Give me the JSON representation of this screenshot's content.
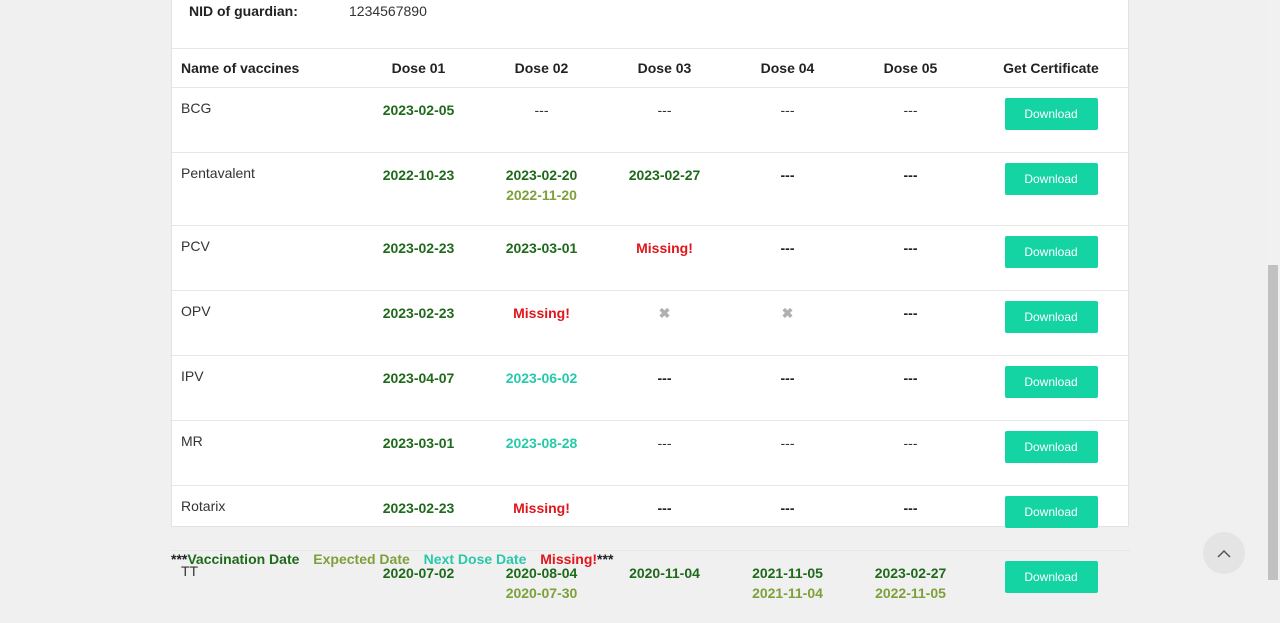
{
  "guardian": {
    "nid_label": "NID of guardian:",
    "nid_value": "1234567890"
  },
  "table": {
    "headers": [
      "Name of vaccines",
      "Dose 01",
      "Dose 02",
      "Dose 03",
      "Dose 04",
      "Dose 05",
      "Get Certificate"
    ],
    "download_label": "Download",
    "rows": [
      {
        "name": "BCG",
        "doses": [
          [
            {
              "t": "vd",
              "v": "2023-02-05"
            }
          ],
          [
            {
              "t": "dash",
              "v": "---"
            }
          ],
          [
            {
              "t": "dash",
              "v": "---"
            }
          ],
          [
            {
              "t": "dash",
              "v": "---"
            }
          ],
          [
            {
              "t": "dash",
              "v": "---"
            }
          ]
        ]
      },
      {
        "name": "Pentavalent",
        "doses": [
          [
            {
              "t": "vd",
              "v": "2022-10-23"
            }
          ],
          [
            {
              "t": "vd",
              "v": "2023-02-20"
            },
            {
              "t": "ed",
              "v": "2022-11-20"
            }
          ],
          [
            {
              "t": "vd",
              "v": "2023-02-27"
            }
          ],
          [
            {
              "t": "dashb",
              "v": "---"
            }
          ],
          [
            {
              "t": "dashb",
              "v": "---"
            }
          ]
        ]
      },
      {
        "name": "PCV",
        "doses": [
          [
            {
              "t": "vd",
              "v": "2023-02-23"
            }
          ],
          [
            {
              "t": "vd",
              "v": "2023-03-01"
            }
          ],
          [
            {
              "t": "ms",
              "v": "Missing!"
            }
          ],
          [
            {
              "t": "dashb",
              "v": "---"
            }
          ],
          [
            {
              "t": "dashb",
              "v": "---"
            }
          ]
        ]
      },
      {
        "name": "OPV",
        "doses": [
          [
            {
              "t": "vd",
              "v": "2023-02-23"
            }
          ],
          [
            {
              "t": "ms",
              "v": "Missing!"
            }
          ],
          [
            {
              "t": "xmark",
              "v": "✖"
            }
          ],
          [
            {
              "t": "xmark",
              "v": "✖"
            }
          ],
          [
            {
              "t": "dashb",
              "v": "---"
            }
          ]
        ]
      },
      {
        "name": "IPV",
        "doses": [
          [
            {
              "t": "vd",
              "v": "2023-04-07"
            }
          ],
          [
            {
              "t": "nd",
              "v": "2023-06-02"
            }
          ],
          [
            {
              "t": "dashb",
              "v": "---"
            }
          ],
          [
            {
              "t": "dashb",
              "v": "---"
            }
          ],
          [
            {
              "t": "dashb",
              "v": "---"
            }
          ]
        ]
      },
      {
        "name": "MR",
        "doses": [
          [
            {
              "t": "vd",
              "v": "2023-03-01"
            }
          ],
          [
            {
              "t": "nd",
              "v": "2023-08-28"
            }
          ],
          [
            {
              "t": "dash",
              "v": "---"
            }
          ],
          [
            {
              "t": "dash",
              "v": "---"
            }
          ],
          [
            {
              "t": "dash",
              "v": "---"
            }
          ]
        ]
      },
      {
        "name": "Rotarix",
        "doses": [
          [
            {
              "t": "vd",
              "v": "2023-02-23"
            }
          ],
          [
            {
              "t": "ms",
              "v": "Missing!"
            }
          ],
          [
            {
              "t": "dashb",
              "v": "---"
            }
          ],
          [
            {
              "t": "dashb",
              "v": "---"
            }
          ],
          [
            {
              "t": "dashb",
              "v": "---"
            }
          ]
        ]
      },
      {
        "name": "TT",
        "doses": [
          [
            {
              "t": "vd",
              "v": "2020-07-02"
            }
          ],
          [
            {
              "t": "vd",
              "v": "2020-08-04"
            },
            {
              "t": "ed",
              "v": "2020-07-30"
            }
          ],
          [
            {
              "t": "vd",
              "v": "2020-11-04"
            }
          ],
          [
            {
              "t": "vd",
              "v": "2021-11-05"
            },
            {
              "t": "ed",
              "v": "2021-11-04"
            }
          ],
          [
            {
              "t": "vd",
              "v": "2023-02-27"
            },
            {
              "t": "ed",
              "v": "2022-11-05"
            }
          ]
        ]
      }
    ]
  },
  "legend": {
    "prefix": "***",
    "vaccination": "Vaccination Date",
    "expected": "Expected Date",
    "next": "Next Dose Date",
    "missing": "Missing!",
    "suffix": "***"
  },
  "colors": {
    "vaccination": "#1e6a1a",
    "expected": "#7ea03a",
    "next_dose": "#27c9a9",
    "missing": "#e0161c",
    "download_button": "#14d4a4"
  },
  "icons": {
    "scroll_top": "chevron-up-icon",
    "not_applicable": "x-mark-icon"
  }
}
